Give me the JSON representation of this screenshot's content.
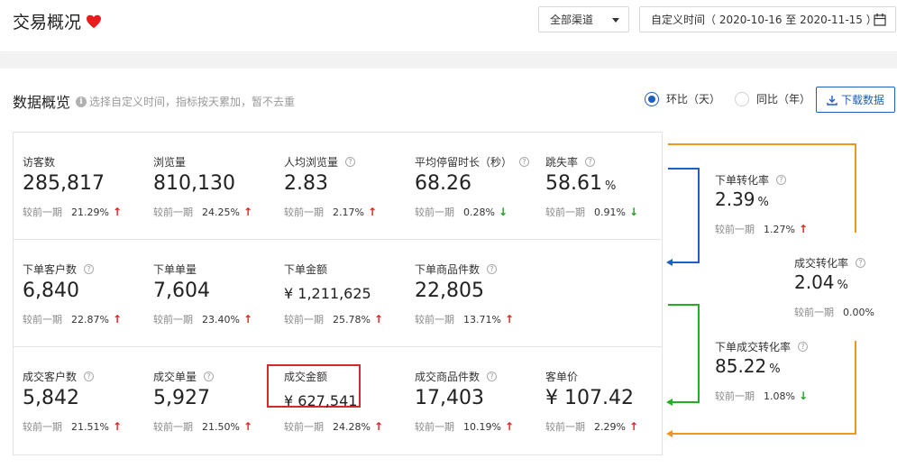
{
  "header": {
    "title": "交易概况",
    "channel": "全部渠道",
    "date_range": "自定义时间（ 2020-10-16 至 2020-11-15 ）"
  },
  "overview": {
    "title": "数据概览",
    "hint": "选择自定义时间，指标按天累加，暂不去重",
    "compare_options": [
      "环比（天）",
      "同比（年）"
    ],
    "selected_compare": "环比（天）",
    "download": "下载数据",
    "compare_label": "较前一期"
  },
  "rows": [
    [
      {
        "name": "访客数",
        "value": "285,817",
        "unit": "",
        "change": "21.29%",
        "dir": "up",
        "help": false
      },
      {
        "name": "浏览量",
        "value": "810,130",
        "unit": "",
        "change": "24.25%",
        "dir": "up",
        "help": false
      },
      {
        "name": "人均浏览量",
        "value": "2.83",
        "unit": "",
        "change": "2.17%",
        "dir": "up",
        "help": true
      },
      {
        "name": "平均停留时长（秒）",
        "value": "68.26",
        "unit": "",
        "change": "0.28%",
        "dir": "down",
        "help": true
      },
      {
        "name": "跳失率",
        "value": "58.61",
        "unit": "%",
        "change": "0.91%",
        "dir": "down",
        "help": true
      }
    ],
    [
      {
        "name": "下单客户数",
        "value": "6,840",
        "unit": "",
        "change": "22.87%",
        "dir": "up",
        "help": true
      },
      {
        "name": "下单单量",
        "value": "7,604",
        "unit": "",
        "change": "23.40%",
        "dir": "up",
        "help": false
      },
      {
        "name": "下单金额",
        "value": "¥ 1,211,625",
        "unit": "",
        "change": "25.78%",
        "dir": "up",
        "help": false,
        "money": true
      },
      {
        "name": "下单商品件数",
        "value": "22,805",
        "unit": "",
        "change": "13.71%",
        "dir": "up",
        "help": true
      }
    ],
    [
      {
        "name": "成交客户数",
        "value": "5,842",
        "unit": "",
        "change": "21.51%",
        "dir": "up",
        "help": true
      },
      {
        "name": "成交单量",
        "value": "5,927",
        "unit": "",
        "change": "21.50%",
        "dir": "up",
        "help": true
      },
      {
        "name": "成交金额",
        "value": "¥ 627,541",
        "unit": "",
        "change": "24.28%",
        "dir": "up",
        "help": false,
        "money": true
      },
      {
        "name": "成交商品件数",
        "value": "17,403",
        "unit": "",
        "change": "10.19%",
        "dir": "up",
        "help": true
      },
      {
        "name": "客单价",
        "value": "¥ 107.42",
        "unit": "",
        "change": "2.29%",
        "dir": "up",
        "help": false
      }
    ]
  ],
  "side": [
    {
      "name": "下单转化率",
      "value": "2.39",
      "unit": "%",
      "change": "1.27%",
      "dir": "up"
    },
    {
      "name": "成交转化率",
      "value": "2.04",
      "unit": "%",
      "change": "0.00%",
      "dir": "none"
    },
    {
      "name": "下单成交转化率",
      "value": "85.22",
      "unit": "%",
      "change": "1.08%",
      "dir": "down"
    }
  ],
  "colors": {
    "accent": "#1e5fbf",
    "up": "#e02020",
    "down": "#22a022",
    "flow_orange": "#f0951e",
    "flow_blue": "#1e5fbf",
    "flow_green": "#22b022",
    "highlight": "#d32a2a"
  }
}
